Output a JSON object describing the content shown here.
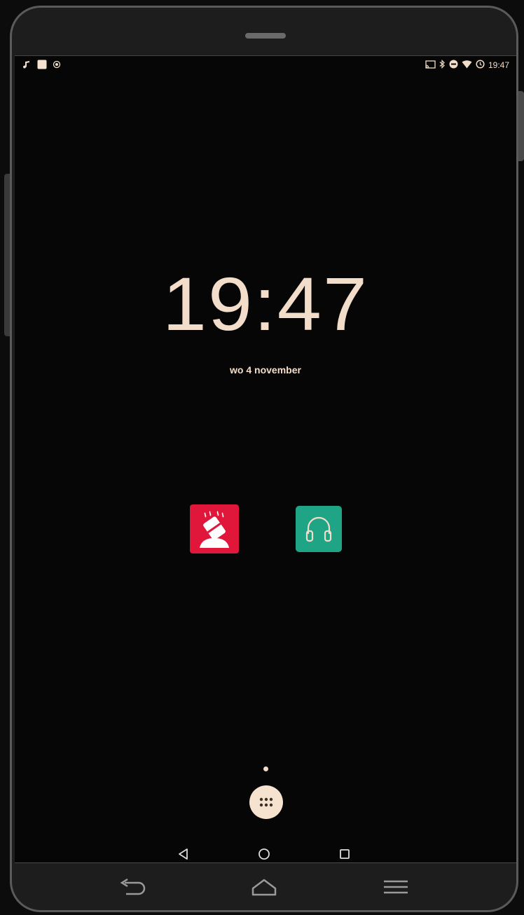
{
  "statusbar": {
    "time": "19:47",
    "left_icons": [
      "music-note-icon",
      "image-notification-icon",
      "target-icon"
    ],
    "right_icons": [
      "cast-icon",
      "bluetooth-icon",
      "do-not-disturb-icon",
      "wifi-icon",
      "alarm-icon"
    ]
  },
  "lockscreen": {
    "clock": "19:47",
    "date": "wo 4 november"
  },
  "apps": [
    {
      "icon": "red-app-icon",
      "color": "#e0163a"
    },
    {
      "icon": "headphones-icon",
      "color": "#1fa486"
    }
  ],
  "navigation": {
    "soft_keys": [
      "back-triangle-icon",
      "home-circle-icon",
      "recents-square-icon"
    ],
    "hardware_keys": [
      "back-arrow-icon",
      "home-house-icon",
      "menu-lines-icon"
    ]
  },
  "colors": {
    "accent_text": "#f1ddc9",
    "background": "#060606"
  }
}
